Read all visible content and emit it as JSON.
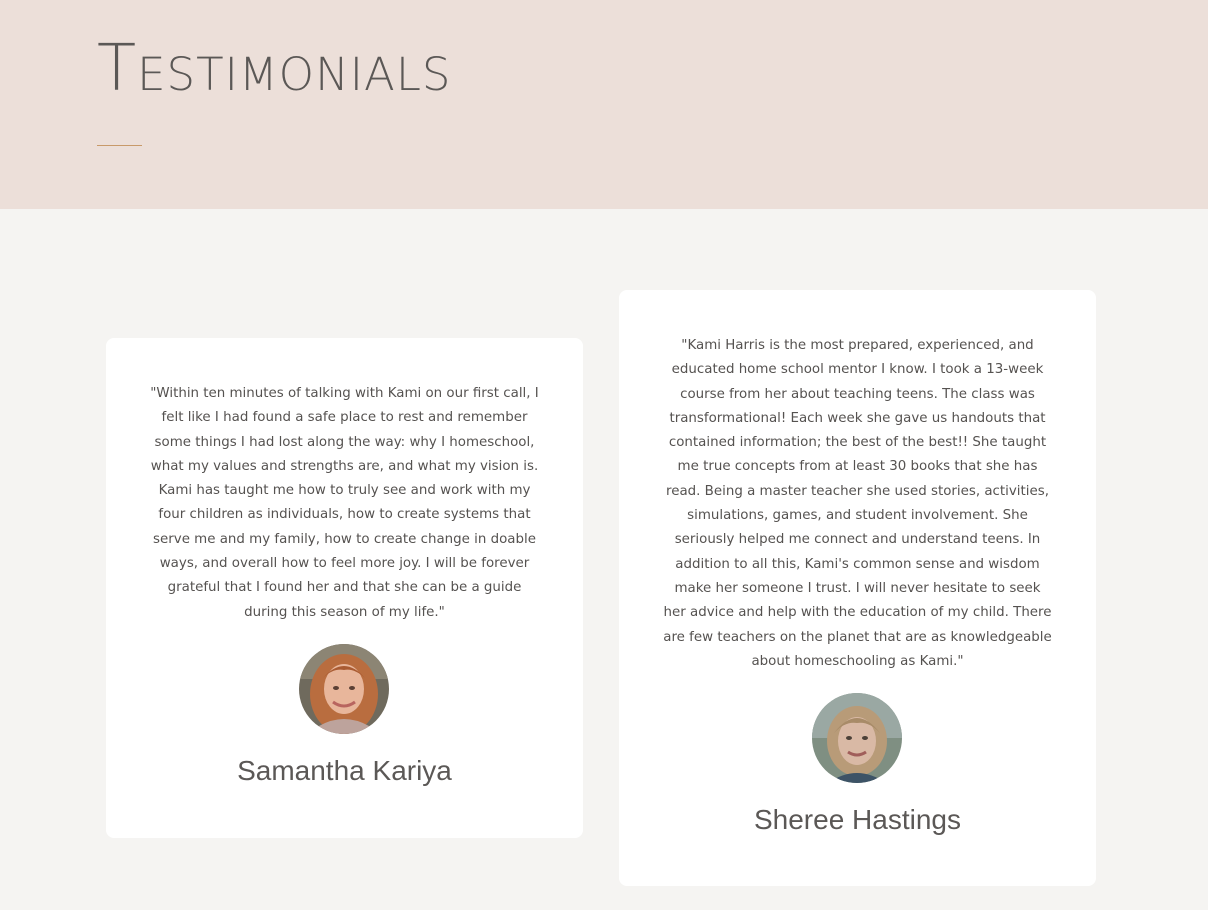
{
  "header": {
    "title": "Testimonials"
  },
  "colors": {
    "hero_background": "#ecdfd9",
    "page_background": "#f5f4f2",
    "accent_rule": "#c89a6a",
    "text": "#555250"
  },
  "testimonials": [
    {
      "quote": "\"Within ten minutes of talking with Kami on our first call, I felt like I had found a safe place to rest and remember some things I had lost along the way: why I homeschool, what my values and strengths are, and what my vision is. Kami has taught me how to truly see and work with my four children as individuals, how to create systems that serve me and my family, how to create change in doable ways, and overall how to feel more joy. I will be forever grateful that I found her and that she can be a guide during this season of my life.\"",
      "name": "Samantha Kariya",
      "avatar_icon": "portrait-photo"
    },
    {
      "quote": "\"Kami Harris is the most prepared, experienced, and educated home school mentor I know. I took a 13-week course from her about teaching teens. The class was transformational! Each week she gave us handouts that contained information; the best of the best!! She taught me true concepts from at least 30 books that she has read. Being a master teacher she used stories, activities, simulations, games, and student involvement. She seriously helped me connect and understand teens. In addition to all this, Kami's common sense and wisdom make her someone I trust. I will never hesitate to seek her advice and help with the education of my child. There are few teachers on the planet that are as knowledgeable about homeschooling as Kami.\"",
      "name": "Sheree Hastings",
      "avatar_icon": "portrait-photo"
    }
  ]
}
